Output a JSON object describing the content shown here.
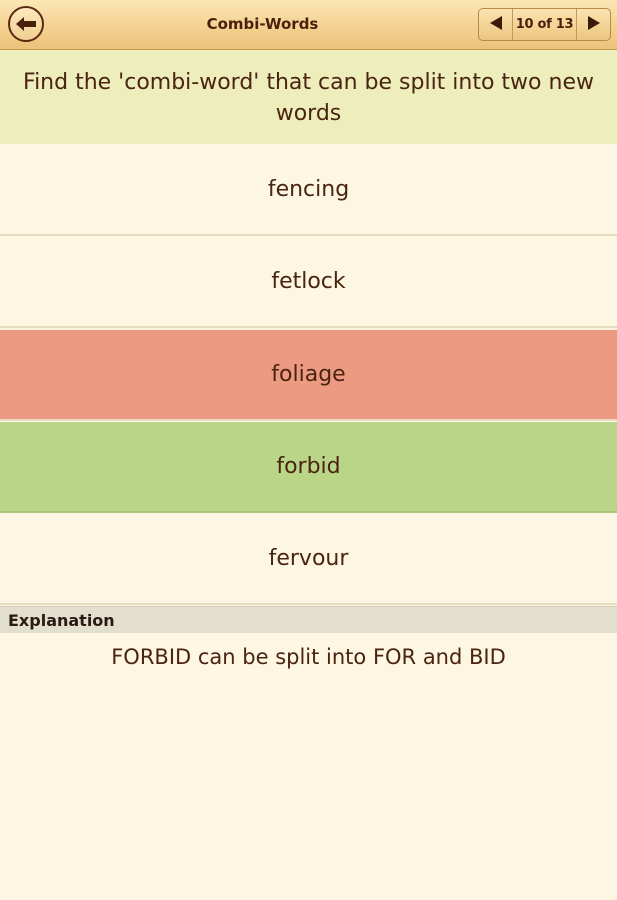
{
  "header": {
    "title": "Combi-Words",
    "back_icon": "back-arrow-icon",
    "pager": {
      "label": "10 of 13",
      "prev_icon": "triangle-left-icon",
      "next_icon": "triangle-right-icon"
    }
  },
  "question": "Find the 'combi-word' that can be split into two new words",
  "options": [
    {
      "label": "fencing",
      "state": "normal"
    },
    {
      "label": "fetlock",
      "state": "normal"
    },
    {
      "label": "foliage",
      "state": "wrong"
    },
    {
      "label": "forbid",
      "state": "correct"
    },
    {
      "label": "fervour",
      "state": "normal"
    }
  ],
  "explanation": {
    "heading": "Explanation",
    "text": "FORBID can be split into FOR and BID"
  },
  "colors": {
    "background": "#fcf6e2",
    "question_bg": "#eeeebd",
    "wrong": "#ec9b82",
    "correct": "#b9d688",
    "text": "#4a2410"
  }
}
